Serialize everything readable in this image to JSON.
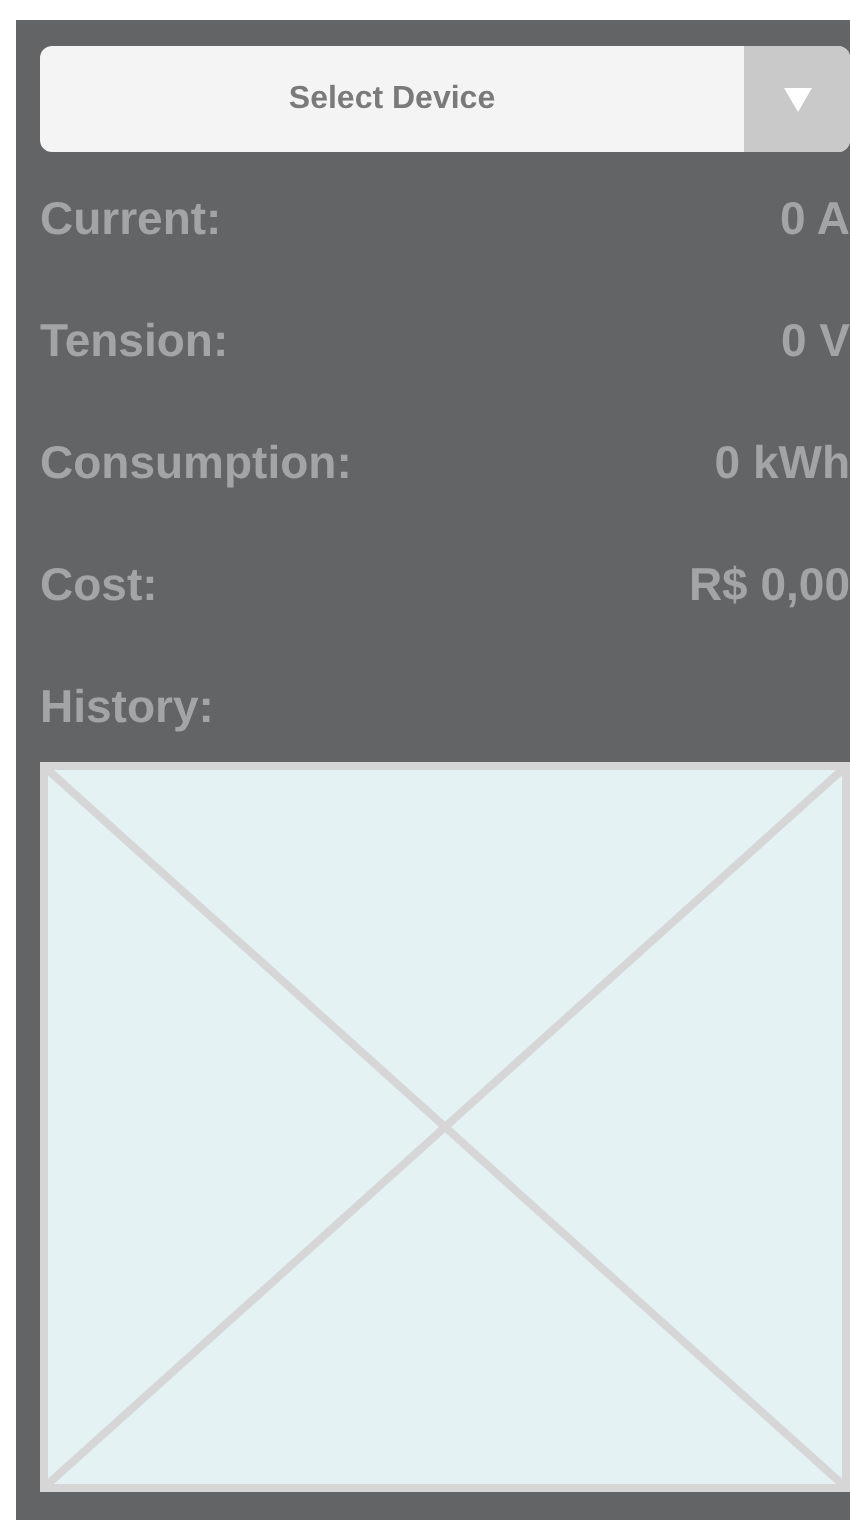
{
  "device_select": {
    "placeholder": "Select Device"
  },
  "readings": [
    {
      "label": "Current:",
      "value": "0 A"
    },
    {
      "label": "Tension:",
      "value": "0 V"
    },
    {
      "label": "Consumption:",
      "value": "0 kWh"
    },
    {
      "label": "Cost:",
      "value": "R$ 0,00"
    }
  ],
  "history": {
    "label": "History:"
  }
}
